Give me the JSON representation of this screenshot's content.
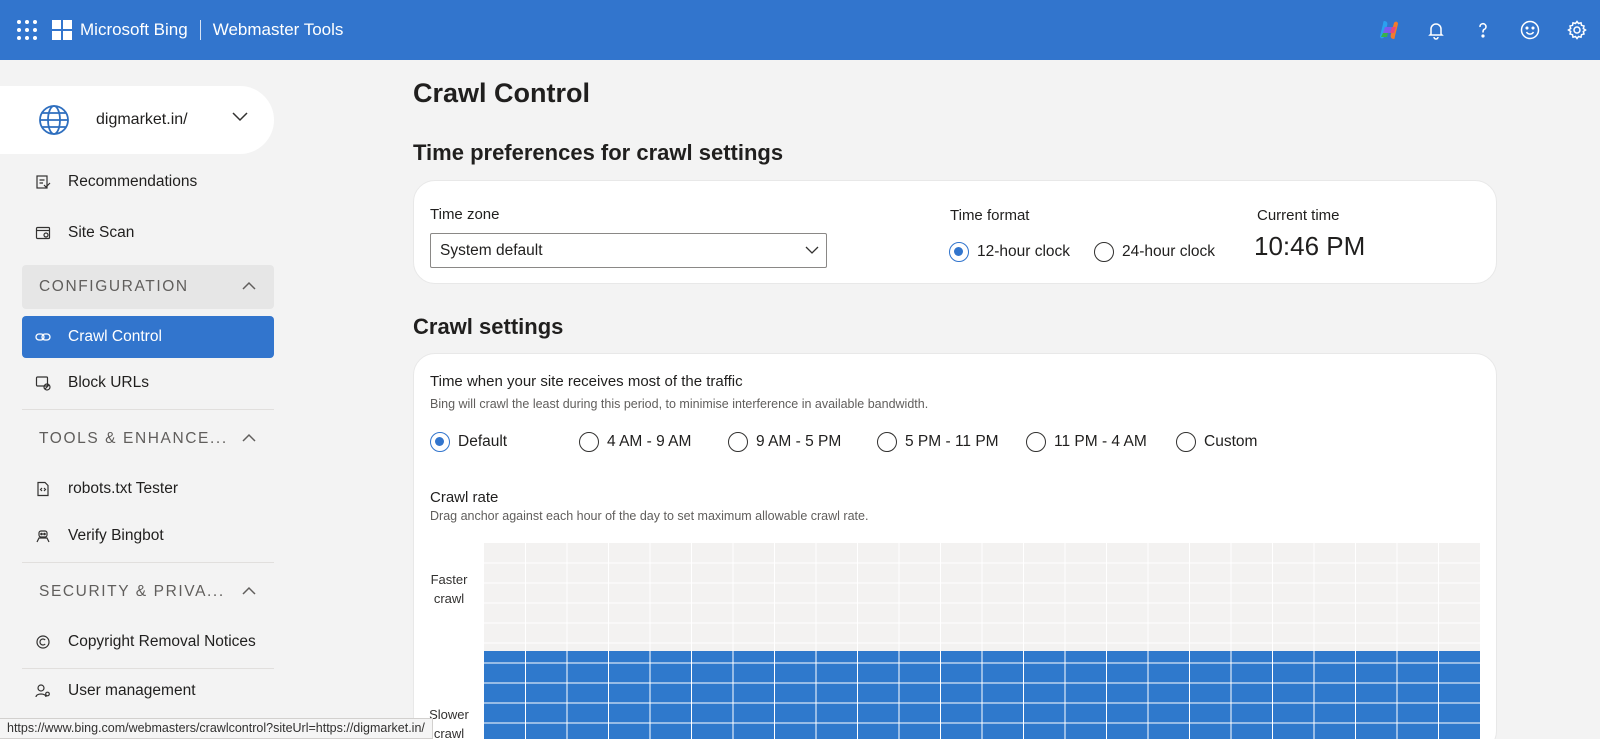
{
  "header": {
    "brand": "Microsoft Bing",
    "product": "Webmaster Tools",
    "icons": [
      "app-launcher-icon",
      "copilot-icon",
      "bell-icon",
      "help-icon",
      "feedback-smiley-icon",
      "settings-gear-icon"
    ],
    "bar_color": "#3275cd"
  },
  "sidebar": {
    "site": "digmarket.in/",
    "items": [
      {
        "label": "Recommendations",
        "icon": "recommendations-icon"
      },
      {
        "label": "Site Scan",
        "icon": "site-scan-icon"
      }
    ],
    "sections": [
      {
        "label": "CONFIGURATION",
        "items": [
          {
            "label": "Crawl Control",
            "icon": "crawl-control-icon",
            "active": true
          },
          {
            "label": "Block URLs",
            "icon": "block-urls-icon"
          }
        ]
      },
      {
        "label": "TOOLS & ENHANCE...",
        "items": [
          {
            "label": "robots.txt Tester",
            "icon": "robots-file-icon"
          },
          {
            "label": "Verify Bingbot",
            "icon": "bot-icon"
          }
        ]
      },
      {
        "label": "SECURITY & PRIVA...",
        "items": [
          {
            "label": "Copyright Removal Notices",
            "icon": "copyright-icon"
          },
          {
            "label": "User management",
            "icon": "user-management-icon"
          }
        ]
      }
    ]
  },
  "main": {
    "title": "Crawl Control",
    "time_prefs": {
      "heading": "Time preferences for crawl settings",
      "timezone_label": "Time zone",
      "timezone_value": "System default",
      "format_label": "Time format",
      "format_options": [
        "12-hour clock",
        "24-hour clock"
      ],
      "format_selected": "12-hour clock",
      "current_time_label": "Current time",
      "current_time": "10:46 PM"
    },
    "crawl_settings": {
      "heading": "Crawl settings",
      "traffic_title": "Time when your site receives most of the traffic",
      "traffic_desc": "Bing will crawl the least during this period, to minimise interference in available bandwidth.",
      "traffic_options": [
        "Default",
        "4 AM - 9 AM",
        "9 AM - 5 PM",
        "5 PM - 11 PM",
        "11 PM - 4 AM",
        "Custom"
      ],
      "traffic_selected": "Default",
      "rate_title": "Crawl rate",
      "rate_desc": "Drag anchor against each hour of the day to set maximum allowable crawl rate.",
      "y_top": "Faster crawl",
      "y_bottom": "Slower crawl",
      "hours": 24,
      "levels": 10,
      "level_per_hour": [
        5,
        5,
        5,
        5,
        5,
        5,
        5,
        5,
        5,
        5,
        5,
        5,
        5,
        5,
        5,
        5,
        5,
        5,
        5,
        5,
        5,
        5,
        5,
        5
      ],
      "accent_color": "#2f79cc"
    }
  },
  "status_url": "https://www.bing.com/webmasters/crawlcontrol?siteUrl=https://digmarket.in/"
}
